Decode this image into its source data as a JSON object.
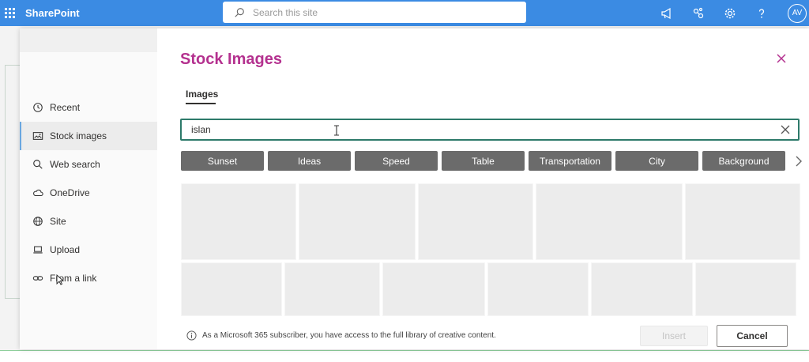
{
  "suitebar": {
    "brand": "SharePoint",
    "search_placeholder": "Search this site",
    "avatar_initials": "AV",
    "icons": [
      "waffle-icon",
      "megaphone-icon",
      "share-network-icon",
      "gear-icon",
      "help-icon"
    ]
  },
  "dialog": {
    "title": "Stock Images",
    "tab": "Images",
    "query": "islan",
    "nav": [
      {
        "label": "Recent",
        "icon": "clock-icon",
        "active": false
      },
      {
        "label": "Stock images",
        "icon": "image-icon",
        "active": true
      },
      {
        "label": "Web search",
        "icon": "search-icon",
        "active": false
      },
      {
        "label": "OneDrive",
        "icon": "cloud-icon",
        "active": false
      },
      {
        "label": "Site",
        "icon": "globe-icon",
        "active": false
      },
      {
        "label": "Upload",
        "icon": "laptop-icon",
        "active": false
      },
      {
        "label": "From a link",
        "icon": "link-icon",
        "active": false
      }
    ],
    "chips": [
      "Sunset",
      "Ideas",
      "Speed",
      "Table",
      "Transportation",
      "City",
      "Background"
    ],
    "info_text": "As a Microsoft 365 subscriber, you have access to the full library of creative content.",
    "insert_label": "Insert",
    "cancel_label": "Cancel"
  },
  "colors": {
    "suitebar": "#3b8be3",
    "title": "#b4318f",
    "query_border": "#2d7a6a",
    "chip": "#6b6b6b"
  }
}
